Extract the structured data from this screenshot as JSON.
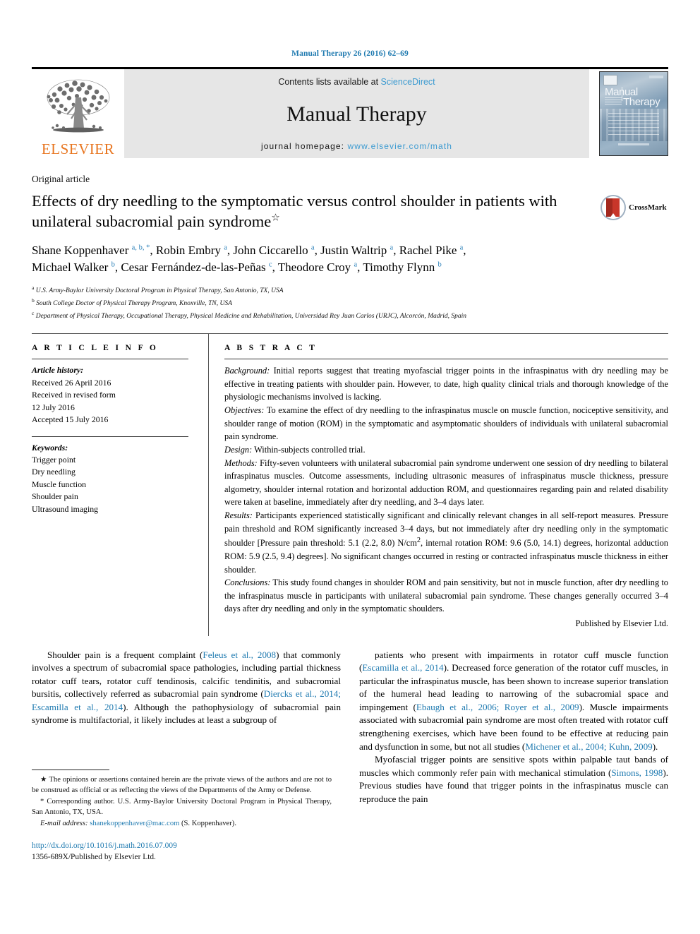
{
  "running_head": "Manual Therapy 26 (2016) 62–69",
  "masthead": {
    "publisher_logo_text": "ELSEVIER",
    "contents_prefix": "Contents lists available at ",
    "contents_link": "ScienceDirect",
    "journal_name": "Manual Therapy",
    "homepage_prefix": "journal homepage: ",
    "homepage_url": "www.elsevier.com/math",
    "cover_title_line1": "Manual",
    "cover_title_line2": "Therapy"
  },
  "article": {
    "category": "Original article",
    "title": "Effects of dry needling to the symptomatic versus control shoulder in patients with unilateral subacromial pain syndrome",
    "title_marker": "☆",
    "crossmark_label": "CrossMark",
    "authors_line1": "Shane Koppenhaver <sup>a, b, *</sup>, Robin Embry <sup>a</sup>, John Ciccarello <sup>a</sup>, Justin Waltrip <sup>a</sup>, Rachel Pike <sup>a</sup>,",
    "authors_line2": "Michael Walker <sup>b</sup>, Cesar Fernández-de-las-Peñas <sup>c</sup>, Theodore Croy <sup>a</sup>, Timothy Flynn <sup>b</sup>",
    "affiliations": [
      {
        "mark": "a",
        "text": "U.S. Army-Baylor University Doctoral Program in Physical Therapy, San Antonio, TX, USA"
      },
      {
        "mark": "b",
        "text": "South College Doctor of Physical Therapy Program, Knoxville, TN, USA"
      },
      {
        "mark": "c",
        "text": "Department of Physical Therapy, Occupational Therapy, Physical Medicine and Rehabilitation, Universidad Rey Juan Carlos (URJC), Alcorcón, Madrid, Spain"
      }
    ]
  },
  "article_info": {
    "heading": "A R T I C L E  I N F O",
    "history_label": "Article history:",
    "history_lines": [
      "Received 26 April 2016",
      "Received in revised form",
      "12 July 2016",
      "Accepted 15 July 2016"
    ],
    "keywords_label": "Keywords:",
    "keywords": [
      "Trigger point",
      "Dry needling",
      "Muscle function",
      "Shoulder pain",
      "Ultrasound imaging"
    ]
  },
  "abstract": {
    "heading": "A B S T R A C T",
    "sections": [
      {
        "label": "Background:",
        "text": " Initial reports suggest that treating myofascial trigger points in the infraspinatus with dry needling may be effective in treating patients with shoulder pain. However, to date, high quality clinical trials and thorough knowledge of the physiologic mechanisms involved is lacking."
      },
      {
        "label": "Objectives:",
        "text": " To examine the effect of dry needling to the infraspinatus muscle on muscle function, nociceptive sensitivity, and shoulder range of motion (ROM) in the symptomatic and asymptomatic shoulders of individuals with unilateral subacromial pain syndrome."
      },
      {
        "label": "Design:",
        "text": " Within-subjects controlled trial."
      },
      {
        "label": "Methods:",
        "text": " Fifty-seven volunteers with unilateral subacromial pain syndrome underwent one session of dry needling to bilateral infraspinatus muscles. Outcome assessments, including ultrasonic measures of infraspinatus muscle thickness, pressure algometry, shoulder internal rotation and horizontal adduction ROM, and questionnaires regarding pain and related disability were taken at baseline, immediately after dry needling, and 3–4 days later."
      },
      {
        "label": "Results:",
        "text": " Participants experienced statistically significant and clinically relevant changes in all self-report measures. Pressure pain threshold and ROM significantly increased 3–4 days, but not immediately after dry needling only in the symptomatic shoulder [Pressure pain threshold: 5.1 (2.2, 8.0) N/cm<sup>2</sup>, internal rotation ROM: 9.6 (5.0, 14.1) degrees, horizontal adduction ROM: 5.9 (2.5, 9.4) degrees]. No significant changes occurred in resting or contracted infraspinatus muscle thickness in either shoulder."
      },
      {
        "label": "Conclusions:",
        "text": " This study found changes in shoulder ROM and pain sensitivity, but not in muscle function, after dry needling to the infraspinatus muscle in participants with unilateral subacromial pain syndrome. These changes generally occurred 3–4 days after dry needling and only in the symptomatic shoulders."
      }
    ],
    "signature": "Published by Elsevier Ltd."
  },
  "body": {
    "left_paragraphs": [
      "Shoulder pain is a frequent complaint (<a class=\"ref\" href=\"#\">Feleus et al., 2008</a>) that commonly involves a spectrum of subacromial space pathologies, including partial thickness rotator cuff tears, rotator cuff tendinosis, calcific tendinitis, and subacromial bursitis, collectively referred as subacromial pain syndrome (<a class=\"ref\" href=\"#\">Diercks et al., 2014; Escamilla et al., 2014</a>). Although the pathophysiology of subacromial pain syndrome is multifactorial, it likely includes at least a subgroup of"
    ],
    "right_paragraphs": [
      "patients who present with impairments in rotator cuff muscle function (<a class=\"ref\" href=\"#\">Escamilla et al., 2014</a>). Decreased force generation of the rotator cuff muscles, in particular the infraspinatus muscle, has been shown to increase superior translation of the humeral head leading to narrowing of the subacromial space and impingement (<a class=\"ref\" href=\"#\">Ebaugh et al., 2006; Royer et al., 2009</a>). Muscle impairments associated with subacromial pain syndrome are most often treated with rotator cuff strengthening exercises, which have been found to be effective at reducing pain and dysfunction in some, but not all studies (<a class=\"ref\" href=\"#\">Michener et al., 2004; Kuhn, 2009</a>).",
      "Myofascial trigger points are sensitive spots within palpable taut bands of muscles which commonly refer pain with mechanical stimulation (<a class=\"ref\" href=\"#\">Simons, 1998</a>). Previous studies have found that trigger points in the infraspinatus muscle can reproduce the pain"
    ]
  },
  "footnotes": {
    "note_star": "<span class=\"em\"></span>★ The opinions or assertions contained herein are the private views of the authors and are not to be construed as official or as reflecting the views of the Departments of the Army or Defense.",
    "note_corr": "* Corresponding author. U.S. Army-Baylor University Doctoral Program in Physical Therapy, San Antonio, TX, USA.",
    "email_label": "E-mail address:",
    "email": "shanekoppenhaver@mac.com",
    "email_owner": " (S. Koppenhaver).",
    "doi": "http://dx.doi.org/10.1016/j.math.2016.07.009",
    "issn": "1356-689X/Published by Elsevier Ltd."
  },
  "colors": {
    "link_blue": "#1f7ab0",
    "sciencedirect_blue": "#3d9bd1",
    "elsevier_orange": "#e87722",
    "band_gray": "#e6e6e6"
  }
}
